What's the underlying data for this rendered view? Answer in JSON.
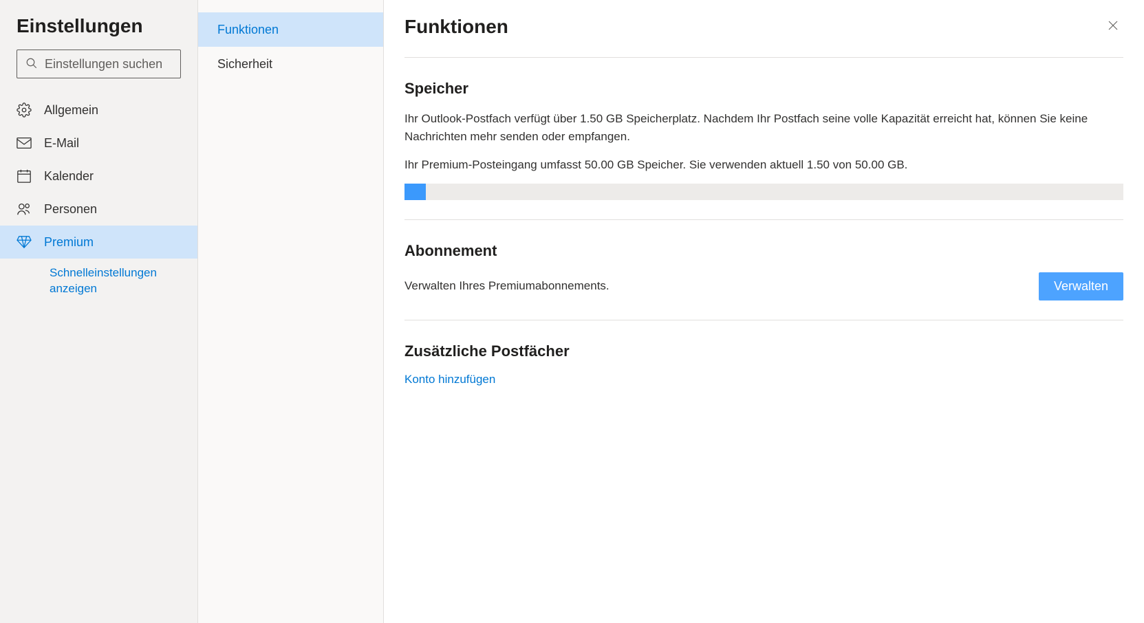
{
  "sidebar": {
    "title": "Einstellungen",
    "search_placeholder": "Einstellungen suchen",
    "items": [
      {
        "label": "Allgemein",
        "icon": "gear"
      },
      {
        "label": "E-Mail",
        "icon": "mail"
      },
      {
        "label": "Kalender",
        "icon": "calendar"
      },
      {
        "label": "Personen",
        "icon": "people"
      },
      {
        "label": "Premium",
        "icon": "diamond",
        "selected": true
      }
    ],
    "quick_link": "Schnelleinstellungen anzeigen"
  },
  "subnav": {
    "items": [
      {
        "label": "Funktionen",
        "selected": true
      },
      {
        "label": "Sicherheit"
      }
    ]
  },
  "main": {
    "title": "Funktionen",
    "storage": {
      "heading": "Speicher",
      "p1": "Ihr Outlook-Postfach verfügt über 1.50 GB Speicherplatz. Nachdem Ihr Postfach seine volle Kapazität erreicht hat, können Sie keine Nachrichten mehr senden oder empfangen.",
      "p2": "Ihr Premium-Posteingang umfasst 50.00 GB Speicher. Sie verwenden aktuell 1.50 von 50.00 GB.",
      "used_gb": 1.5,
      "total_gb": 50.0,
      "progress_percent": 3
    },
    "subscription": {
      "heading": "Abonnement",
      "text": "Verwalten Ihres Premiumabonnements.",
      "button": "Verwalten"
    },
    "mailboxes": {
      "heading": "Zusätzliche Postfächer",
      "add_link": "Konto hinzufügen"
    }
  },
  "colors": {
    "accent": "#0078d4",
    "selected_bg": "#cfe4fa",
    "progress_fill": "#3b99fc",
    "button_bg": "#4da3ff"
  }
}
